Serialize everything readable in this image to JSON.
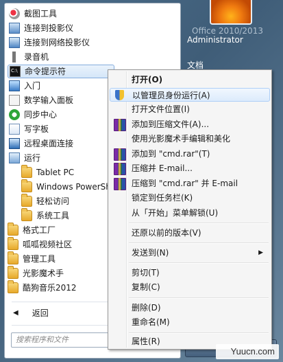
{
  "start_menu": {
    "programs": [
      {
        "label": "截图工具",
        "icon": "scissors-icon"
      },
      {
        "label": "连接到投影仪",
        "icon": "projector-icon"
      },
      {
        "label": "连接到网络投影仪",
        "icon": "network-projector-icon"
      },
      {
        "label": "录音机",
        "icon": "microphone-icon"
      },
      {
        "label": "命令提示符",
        "icon": "cmd-icon"
      },
      {
        "label": "入门",
        "icon": "getting-started-icon"
      },
      {
        "label": "数学输入面板",
        "icon": "math-panel-icon"
      },
      {
        "label": "同步中心",
        "icon": "sync-icon"
      },
      {
        "label": "写字板",
        "icon": "wordpad-icon"
      },
      {
        "label": "远程桌面连接",
        "icon": "remote-desktop-icon"
      },
      {
        "label": "运行",
        "icon": "run-icon"
      },
      {
        "label": "Tablet PC",
        "icon": "folder-icon"
      },
      {
        "label": "Windows PowerSh",
        "icon": "folder-icon"
      },
      {
        "label": "轻松访问",
        "icon": "folder-icon"
      },
      {
        "label": "系统工具",
        "icon": "folder-icon"
      },
      {
        "label": "格式工厂",
        "icon": "folder-icon"
      },
      {
        "label": "呱呱视频社区",
        "icon": "folder-icon"
      },
      {
        "label": "管理工具",
        "icon": "folder-icon"
      },
      {
        "label": "光影魔术手",
        "icon": "folder-icon"
      },
      {
        "label": "酷狗音乐2012",
        "icon": "folder-icon"
      }
    ],
    "back_label": "返回",
    "search_placeholder": "搜索程序和文件"
  },
  "right_panel": {
    "user_name": "Administrator",
    "documents": "文档",
    "faint_text": "Office 2010/2013"
  },
  "context_menu": {
    "items": [
      {
        "label": "打开(O)",
        "bold": true
      },
      {
        "label": "以管理员身份运行(A)",
        "icon": "uac-shield-icon",
        "highlight": true
      },
      {
        "label": "打开文件位置(I)"
      },
      {
        "label": "添加到压缩文件(A)...",
        "icon": "winrar-icon"
      },
      {
        "label": "使用光影魔术手编辑和美化"
      },
      {
        "label": "添加到 \"cmd.rar\"(T)",
        "icon": "winrar-icon"
      },
      {
        "label": "压缩并 E-mail...",
        "icon": "winrar-icon"
      },
      {
        "label": "压缩到 \"cmd.rar\" 并 E-mail",
        "icon": "winrar-icon"
      },
      {
        "label": "锁定到任务栏(K)"
      },
      {
        "label": "从「开始」菜单解锁(U)"
      },
      {
        "label": "还原以前的版本(V)"
      },
      {
        "label": "发送到(N)",
        "submenu": true
      },
      {
        "label": "剪切(T)"
      },
      {
        "label": "复制(C)"
      },
      {
        "label": "删除(D)"
      },
      {
        "label": "重命名(M)"
      },
      {
        "label": "属性(R)"
      }
    ]
  },
  "watermark": "Yuucn.com"
}
